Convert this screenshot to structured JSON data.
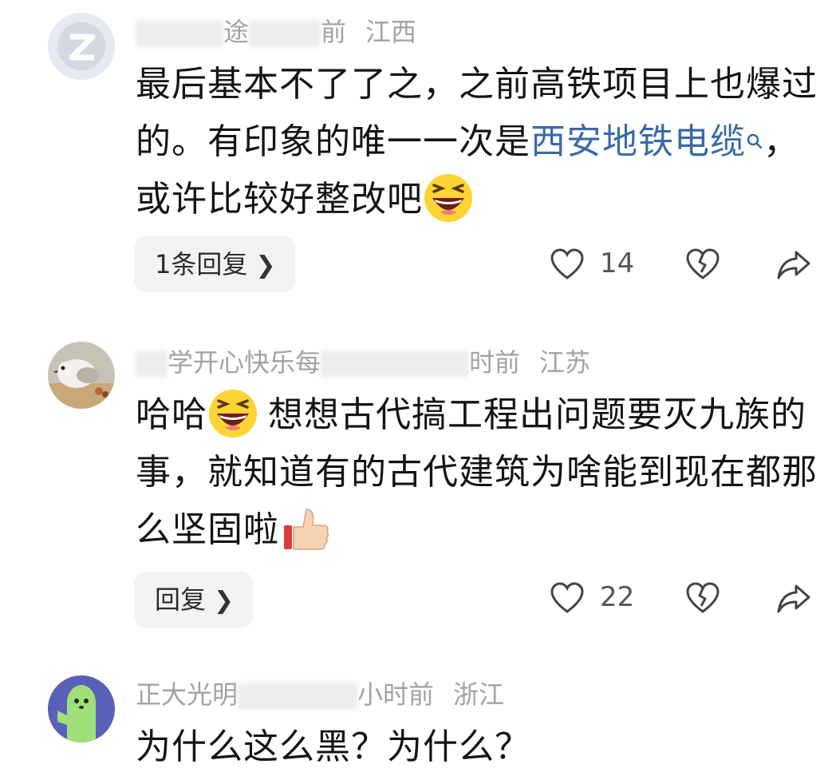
{
  "comments": [
    {
      "meta": {
        "name_fragment": "途",
        "time_fragment": "前",
        "location": "江西"
      },
      "text": {
        "part1": "最后基本不了了之，之前高铁项目上也爆过的。有印象的唯一一次是",
        "link": "西安地铁电缆",
        "part2": "，或许比较好整改吧"
      },
      "emoji": "laughing-emoji",
      "reply_label": "1条回复",
      "likes": "14"
    },
    {
      "meta": {
        "name_fragment": "学开心快乐每",
        "time_fragment": "时前",
        "location": "江苏"
      },
      "text": {
        "part1": "哈哈",
        "part2": "想想古代搞工程出问题要灭九族的事，就知道有的古代建筑为啥能到现在都那么坚固啦"
      },
      "emoji": "laughing-emoji",
      "emoji2": "thumbs-up-emoji",
      "reply_label": "回复",
      "likes": "22"
    },
    {
      "meta": {
        "name_fragment": "正大光明",
        "time_fragment": "小时前",
        "location": "浙江"
      },
      "text": {
        "part1": "为什么这么黑？为什么？"
      }
    }
  ],
  "colors": {
    "link": "#3a6aa6",
    "meta": "#a2a2a2",
    "reply_bg": "#f3f3f3"
  }
}
